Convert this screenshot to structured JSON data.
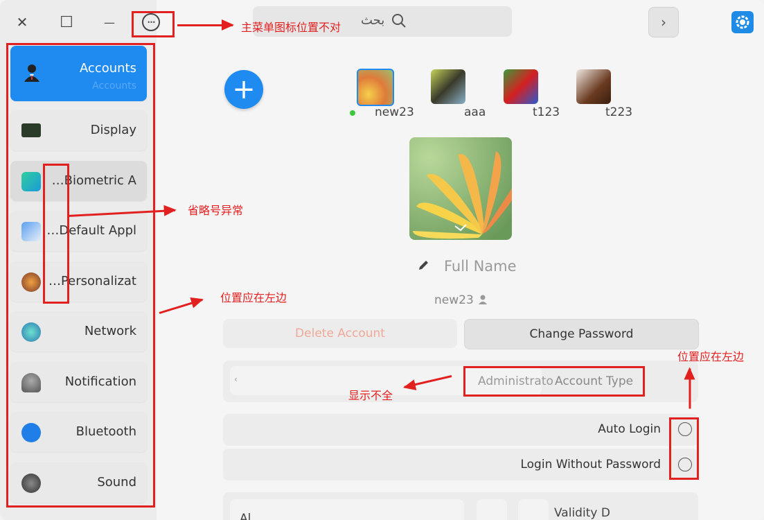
{
  "titlebar": {
    "search_placeholder": "بحث",
    "close_glyph": "✕",
    "maximize_glyph": "☐",
    "minimize_glyph": "—",
    "menu_glyph": "•••",
    "forward_glyph": "›"
  },
  "sidebar": {
    "items": [
      {
        "label": "Accounts",
        "sub": "Accounts",
        "icon": "user-icon"
      },
      {
        "label": "Display",
        "icon": "monitor-icon"
      },
      {
        "label": "…Biometric A",
        "icon": "fingerprint-icon"
      },
      {
        "label": "…Default Appl",
        "icon": "default-apps-icon"
      },
      {
        "label": "…Personalizat",
        "icon": "palette-icon"
      },
      {
        "label": "Network",
        "icon": "network-icon"
      },
      {
        "label": "Notification",
        "icon": "bell-icon"
      },
      {
        "label": "Bluetooth",
        "icon": "bluetooth-icon"
      },
      {
        "label": "Sound",
        "icon": "speaker-icon"
      }
    ]
  },
  "users": [
    {
      "name": "new23",
      "online": true
    },
    {
      "name": "aaa",
      "online": false
    },
    {
      "name": "t123",
      "online": false
    },
    {
      "name": "t223",
      "online": false
    }
  ],
  "account": {
    "full_name_placeholder": "Full Name",
    "username": "new23",
    "delete_label": "Delete Account",
    "change_password_label": "Change Password",
    "account_type_value": "Administrato",
    "account_type_label": "Account Type",
    "auto_login_label": "Auto Login",
    "login_without_password_label": "Login Without Password",
    "validity_label": "Validity D",
    "validity_value": "Al"
  },
  "annotations": {
    "menu_icon_position": "主菜单图标位置不对",
    "ellipsis_abnormal": "省略号异常",
    "should_be_left_1": "位置应在左边",
    "should_be_left_2": "位置应在左边",
    "incomplete_display": "显示不全"
  },
  "colors": {
    "accent": "#1f8af0",
    "annotation": "#e32020",
    "online": "#3cc83c"
  }
}
